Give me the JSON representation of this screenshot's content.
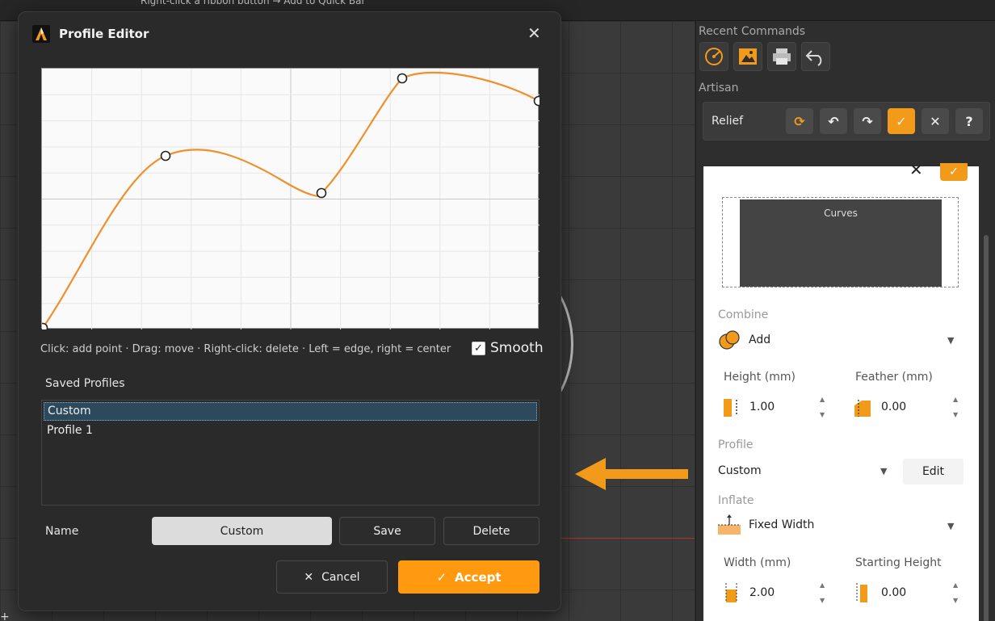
{
  "topbar": {
    "hint": "Right-click a ribbon button → Add to Quick Bar"
  },
  "viewport": {
    "cursor_glyph": "+"
  },
  "recent_commands": {
    "title": "Recent Commands",
    "buttons": [
      {
        "icon": "target-circle-icon"
      },
      {
        "icon": "image-relief-icon"
      },
      {
        "icon": "printer-icon"
      },
      {
        "icon": "undo-curve-icon"
      }
    ]
  },
  "artisan": {
    "title": "Artisan",
    "toolbar_label": "Relief",
    "tools": [
      {
        "icon": "refresh-icon",
        "glyph": "⟳"
      },
      {
        "icon": "undo-icon",
        "glyph": "↶"
      },
      {
        "icon": "redo-icon",
        "glyph": "↷"
      },
      {
        "icon": "check-icon",
        "glyph": "✓"
      },
      {
        "icon": "close-icon",
        "glyph": "✕"
      },
      {
        "icon": "help-icon",
        "glyph": "?"
      }
    ]
  },
  "relief_panel": {
    "close_glyph": "✕",
    "check_glyph": "✓",
    "preview_label": "Curves",
    "combine_label": "Combine",
    "combine_value": "Add",
    "height_label": "Height (mm)",
    "height_value": "1.00",
    "feather_label": "Feather (mm)",
    "feather_value": "0.00",
    "profile_label": "Profile",
    "profile_value": "Custom",
    "edit_label": "Edit",
    "inflate_label": "Inflate",
    "inflate_value": "Fixed Width",
    "width_label": "Width (mm)",
    "width_value": "2.00",
    "starting_height_label": "Starting Height",
    "starting_height_value": "0.00",
    "caret": "▼",
    "spin_up": "▲",
    "spin_down": "▼"
  },
  "dialog": {
    "title": "Profile Editor",
    "close_glyph": "✕",
    "hint": "Click: add point · Drag: move · Right-click: delete · Left = edge, right = center",
    "smooth_label": "Smooth",
    "smooth_checked": "✓",
    "saved_profiles_label": "Saved Profiles",
    "profiles": [
      "Custom",
      "Profile 1"
    ],
    "name_label": "Name",
    "name_value": "Custom",
    "save_label": "Save",
    "delete_label": "Delete",
    "cancel_label": "Cancel",
    "cancel_glyph": "✕",
    "accept_label": "Accept",
    "accept_glyph": "✓",
    "curve_color": "#f0902a",
    "accent_color": "#ff9a10"
  }
}
